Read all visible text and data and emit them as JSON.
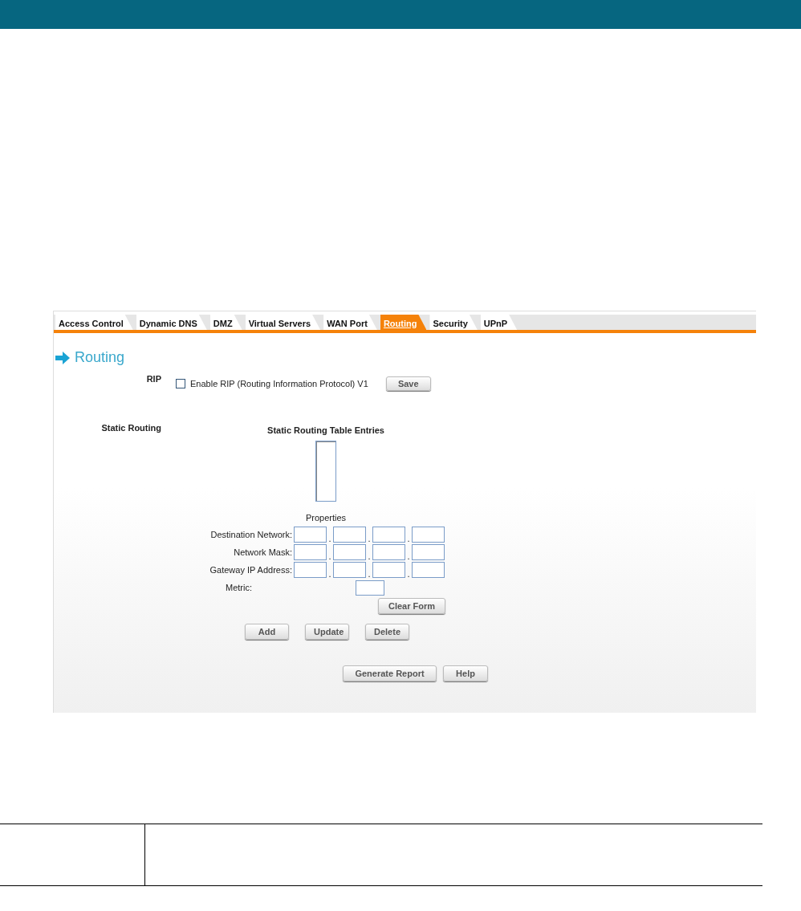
{
  "tabs": [
    {
      "label": "Access Control",
      "selected": false
    },
    {
      "label": "Dynamic DNS",
      "selected": false
    },
    {
      "label": "DMZ",
      "selected": false
    },
    {
      "label": "Virtual Servers",
      "selected": false
    },
    {
      "label": "WAN Port",
      "selected": false
    },
    {
      "label": "Routing",
      "selected": true
    },
    {
      "label": "Security",
      "selected": false
    },
    {
      "label": "UPnP",
      "selected": false
    }
  ],
  "heading": "Routing",
  "rip": {
    "label": "RIP",
    "checkbox_label": "Enable RIP (Routing Information Protocol) V1",
    "checked": false,
    "save_button": "Save"
  },
  "static_routing": {
    "label": "Static Routing",
    "table_title": "Static Routing Table Entries",
    "properties_title": "Properties",
    "ip_rows": [
      {
        "label": "Destination Network:",
        "separators": [
          ".",
          ".",
          "."
        ]
      },
      {
        "label": "Network Mask:",
        "separators": [
          ".",
          ".",
          "."
        ]
      },
      {
        "label": "Gateway IP Address:",
        "separators": [
          ".",
          ".",
          "."
        ]
      }
    ],
    "metric_label": "Metric:",
    "clear_button": "Clear Form",
    "action_buttons": [
      "Add",
      "Update",
      "Delete"
    ]
  },
  "footer_buttons": [
    "Generate Report",
    "Help"
  ]
}
